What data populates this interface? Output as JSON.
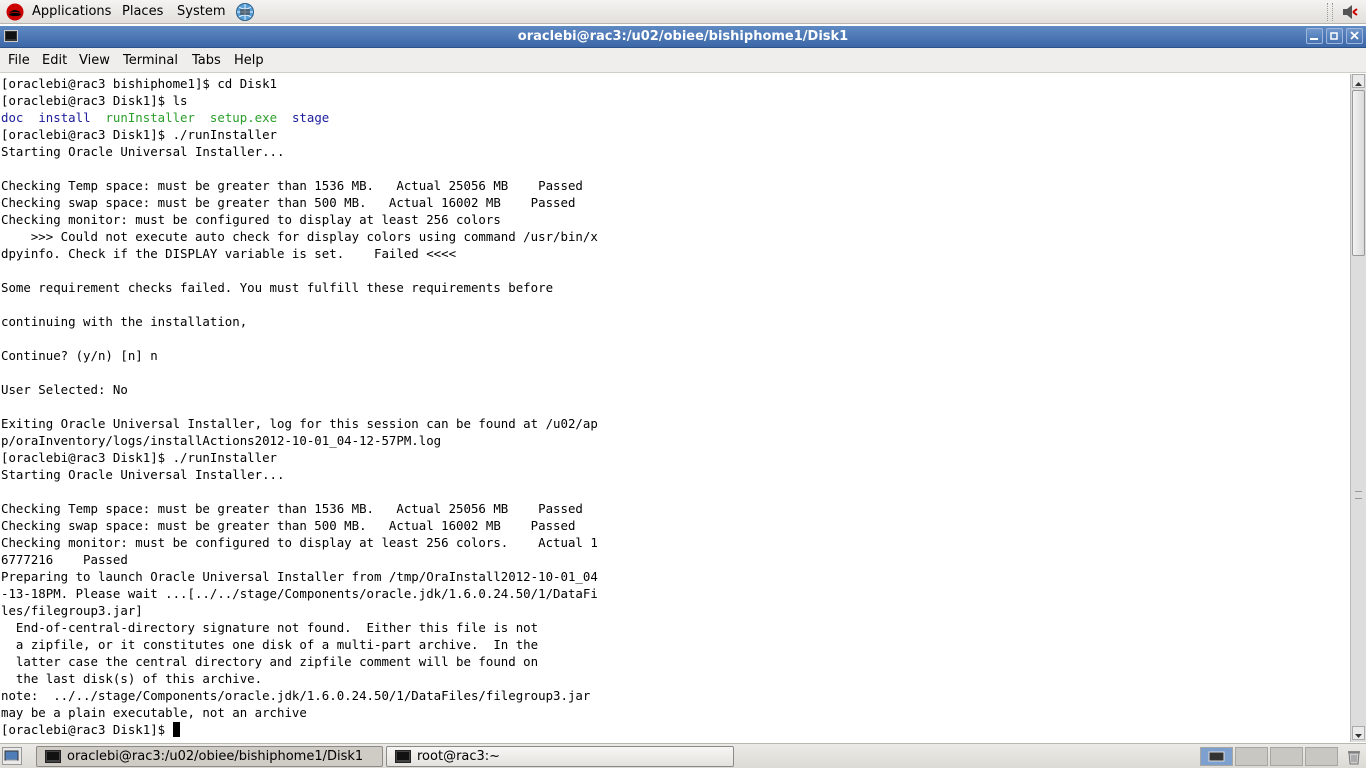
{
  "top_panel": {
    "menus": [
      "Applications",
      "Places",
      "System"
    ],
    "icons": [
      "redhat-logo-icon",
      "network-globe-icon",
      "volume-icon"
    ]
  },
  "window": {
    "title": "oraclebi@rac3:/u02/obiee/bishiphome1/Disk1",
    "buttons": [
      "minimize",
      "maximize",
      "close"
    ]
  },
  "menubar": {
    "file": "File",
    "edit": "Edit",
    "view": "View",
    "terminal": "Terminal",
    "tabs": "Tabs",
    "help": "Help"
  },
  "terminal": {
    "ls_listing": {
      "doc": "doc",
      "install": "install",
      "runInstaller": "runInstaller",
      "setup": "setup.exe",
      "stage": "stage"
    },
    "colors": {
      "directory": "#1c1c9c",
      "executable": "#2a9f2a"
    },
    "lines": [
      "[oraclebi@rac3 bishiphome1]$ cd Disk1",
      "[oraclebi@rac3 Disk1]$ ls",
      "",
      "[oraclebi@rac3 Disk1]$ ./runInstaller",
      "Starting Oracle Universal Installer...",
      "",
      "Checking Temp space: must be greater than 1536 MB.   Actual 25056 MB    Passed",
      "Checking swap space: must be greater than 500 MB.   Actual 16002 MB    Passed",
      "Checking monitor: must be configured to display at least 256 colors",
      "    >>> Could not execute auto check for display colors using command /usr/bin/x",
      "dpyinfo. Check if the DISPLAY variable is set.    Failed <<<<",
      "",
      "Some requirement checks failed. You must fulfill these requirements before",
      "",
      "continuing with the installation,",
      "",
      "Continue? (y/n) [n] n",
      "",
      "User Selected: No",
      "",
      "Exiting Oracle Universal Installer, log for this session can be found at /u02/ap",
      "p/oraInventory/logs/installActions2012-10-01_04-12-57PM.log",
      "[oraclebi@rac3 Disk1]$ ./runInstaller",
      "Starting Oracle Universal Installer...",
      "",
      "Checking Temp space: must be greater than 1536 MB.   Actual 25056 MB    Passed",
      "Checking swap space: must be greater than 500 MB.   Actual 16002 MB    Passed",
      "Checking monitor: must be configured to display at least 256 colors.    Actual 1",
      "6777216    Passed",
      "Preparing to launch Oracle Universal Installer from /tmp/OraInstall2012-10-01_04",
      "-13-18PM. Please wait ...[../../stage/Components/oracle.jdk/1.6.0.24.50/1/DataFi",
      "les/filegroup3.jar]",
      "  End-of-central-directory signature not found.  Either this file is not",
      "  a zipfile, or it constitutes one disk of a multi-part archive.  In the",
      "  latter case the central directory and zipfile comment will be found on",
      "  the last disk(s) of this archive.",
      "note:  ../../stage/Components/oracle.jdk/1.6.0.24.50/1/DataFiles/filegroup3.jar",
      "may be a plain executable, not an archive"
    ],
    "prompt": "[oraclebi@rac3 Disk1]$ "
  },
  "taskbar": {
    "tasks": [
      {
        "label": "oraclebi@rac3:/u02/obiee/bishiphome1/Disk1",
        "active": true
      },
      {
        "label": "root@rac3:~",
        "active": false
      }
    ],
    "workspace_count": 4,
    "active_workspace": 1
  }
}
